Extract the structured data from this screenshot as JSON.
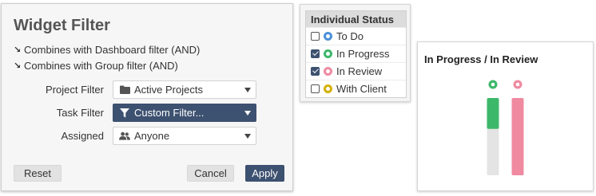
{
  "filter": {
    "title": "Widget Filter",
    "combine_lines": [
      "Combines with Dashboard filter (AND)",
      "Combines with Group filter (AND)"
    ],
    "rows": [
      {
        "label": "Project Filter",
        "value": "Active Projects",
        "icon": "folder-icon"
      },
      {
        "label": "Task Filter",
        "value": "Custom Filter...",
        "icon": "funnel-icon"
      },
      {
        "label": "Assigned",
        "value": "Anyone",
        "icon": "people-icon"
      }
    ],
    "buttons": {
      "reset": "Reset",
      "cancel": "Cancel",
      "apply": "Apply"
    }
  },
  "status": {
    "header": "Individual Status",
    "items": [
      {
        "label": "To Do",
        "checked": false,
        "color": "#4a90d9"
      },
      {
        "label": "In Progress",
        "checked": true,
        "color": "#3cb86a"
      },
      {
        "label": "In Review",
        "checked": true,
        "color": "#f08aa0"
      },
      {
        "label": "With Client",
        "checked": false,
        "color": "#d4b000"
      }
    ]
  },
  "chart_data": {
    "type": "bar",
    "title": "In Progress / In Review",
    "categories": [
      "In Progress",
      "In Review"
    ],
    "series": [
      {
        "colors": [
          "#3cb86a",
          "#f08aa0"
        ],
        "values": [
          0.4,
          1.0
        ]
      }
    ],
    "ylim": [
      0,
      1
    ],
    "grid": false,
    "legend": "none"
  }
}
